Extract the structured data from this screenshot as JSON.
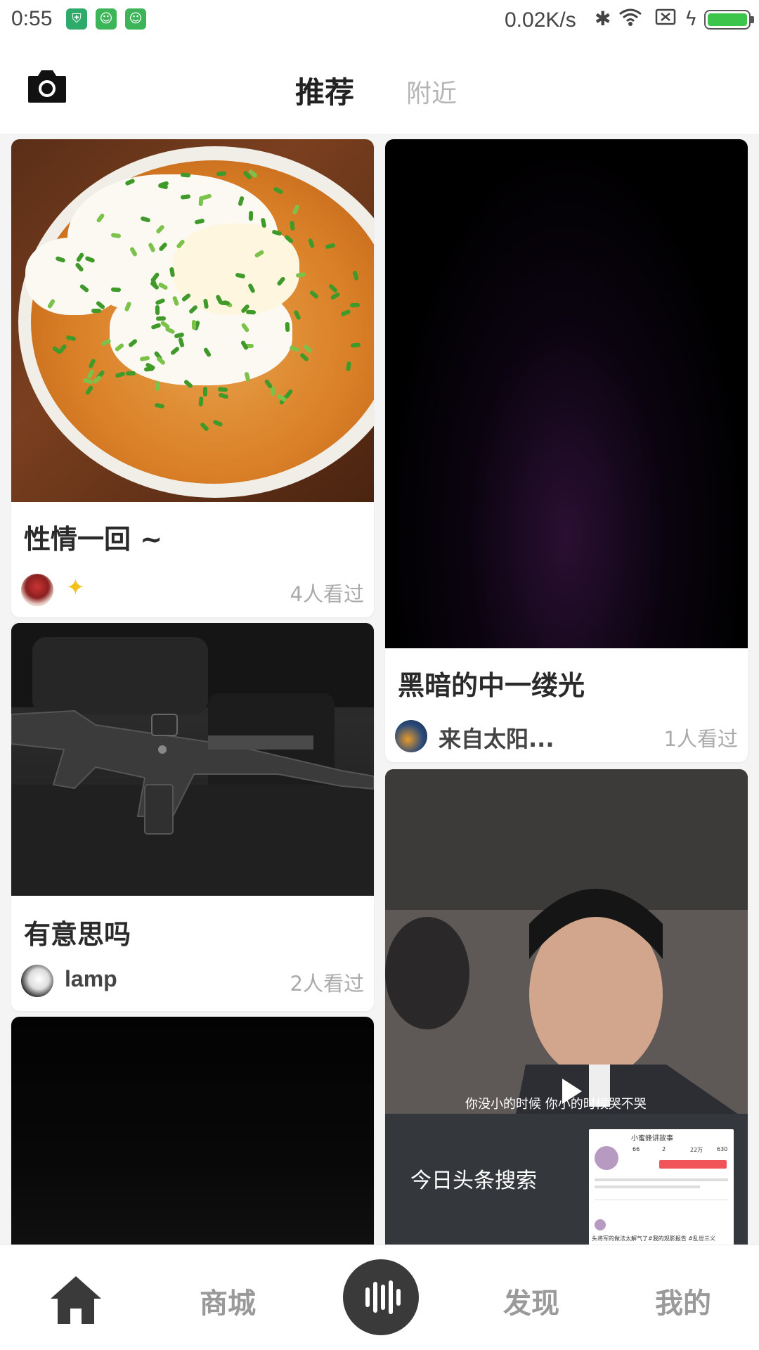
{
  "status_bar": {
    "time": "0:55",
    "network_speed": "0.02K/s",
    "icons": [
      "shield-app-icon",
      "cat-app-icon",
      "cat-app-icon",
      "bluetooth-icon",
      "wifi-icon",
      "sim-none-icon",
      "charging-icon",
      "battery-icon"
    ],
    "battery_level": 1.0,
    "battery_color": "#3cc44b"
  },
  "header": {
    "camera_icon": "camera-icon",
    "tabs": [
      {
        "label": "推荐",
        "active": true
      },
      {
        "label": "附近",
        "active": false
      }
    ]
  },
  "feed": {
    "cards": [
      {
        "title": "性情一回 ~",
        "username": "",
        "views": "4人看过",
        "image": "noodle-soup-bowl"
      },
      {
        "title": "黑暗的中一缕光",
        "username": "来自太阳...",
        "views": "1人看过",
        "image": "dark-purple-glow"
      },
      {
        "title": "有意思吗",
        "username": "lamp",
        "views": "2人看过",
        "image": "rifle-on-bag"
      },
      {
        "title": "",
        "username": "",
        "views": "",
        "image": "dark-video"
      },
      {
        "title": "",
        "username": "",
        "views": "",
        "image": "video-screenshot",
        "overlay": {
          "subtitle": "你没小的时候 你小的时候哭不哭",
          "watermark": "今日头条搜索",
          "inset_title": "小蜜蜂讲故事",
          "inset_stats": [
            "66",
            "2",
            "22万",
            "630"
          ],
          "inset_caption": "头将军的做法太解气了#我的观影报告 #乱世三义"
        }
      }
    ]
  },
  "bottom_nav": {
    "items": [
      {
        "label": "",
        "icon": "home-icon"
      },
      {
        "label": "商城"
      },
      {
        "label": "",
        "icon": "voice-record-icon"
      },
      {
        "label": "发现"
      },
      {
        "label": "我的"
      }
    ]
  }
}
